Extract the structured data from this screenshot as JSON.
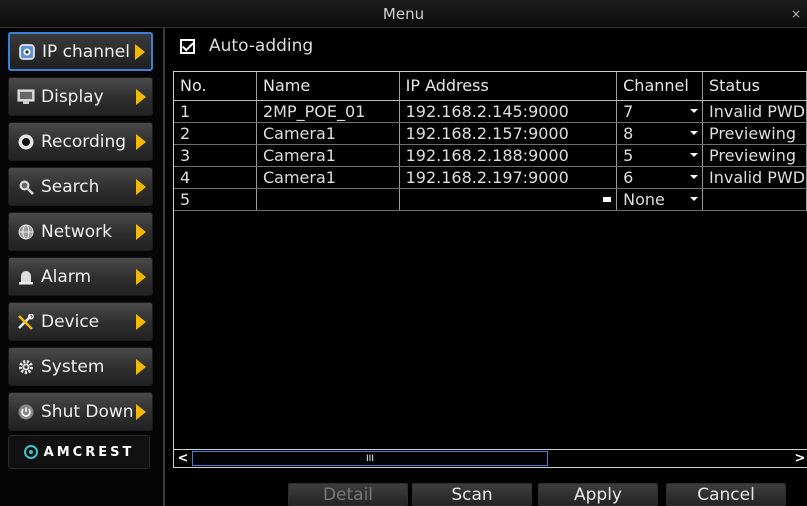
{
  "window": {
    "title": "Menu",
    "close_glyph": "×"
  },
  "sidebar": {
    "items": [
      {
        "label": "IP channel",
        "icon": "ip-camera-icon",
        "active": true
      },
      {
        "label": "Display",
        "icon": "monitor-icon"
      },
      {
        "label": "Recording",
        "icon": "record-icon"
      },
      {
        "label": "Search",
        "icon": "search-icon"
      },
      {
        "label": "Network",
        "icon": "globe-icon"
      },
      {
        "label": "Alarm",
        "icon": "alarm-icon"
      },
      {
        "label": "Device",
        "icon": "tools-icon"
      },
      {
        "label": "System",
        "icon": "gear-icon"
      },
      {
        "label": "Shut Down",
        "icon": "power-icon"
      }
    ],
    "logo_text": "AMCREST"
  },
  "auto_adding": {
    "label": "Auto-adding",
    "checked": true
  },
  "table": {
    "columns": [
      "No.",
      "Name",
      "IP Address",
      "Channel",
      "Status"
    ],
    "rows": [
      {
        "no": "1",
        "name": "2MP_POE_01",
        "ip": "192.168.2.145:9000",
        "channel": "7",
        "status": "Invalid PWD"
      },
      {
        "no": "2",
        "name": "Camera1",
        "ip": "192.168.2.157:9000",
        "channel": "8",
        "status": "Previewing"
      },
      {
        "no": "3",
        "name": "Camera1",
        "ip": "192.168.2.188:9000",
        "channel": "5",
        "status": "Previewing"
      },
      {
        "no": "4",
        "name": "Camera1",
        "ip": "192.168.2.197:9000",
        "channel": "6",
        "status": "Invalid PWD"
      },
      {
        "no": "5",
        "name": "",
        "ip": "",
        "channel": "None",
        "status": ""
      }
    ]
  },
  "scrollbar": {
    "left_glyph": "<",
    "right_glyph": ">",
    "thumb_glyph": "III"
  },
  "buttons": {
    "detail": "Detail",
    "scan": "Scan",
    "apply": "Apply",
    "cancel": "Cancel"
  },
  "colors": {
    "accent_blue": "#3d7fd6",
    "arrow_yellow": "#f5b800"
  }
}
